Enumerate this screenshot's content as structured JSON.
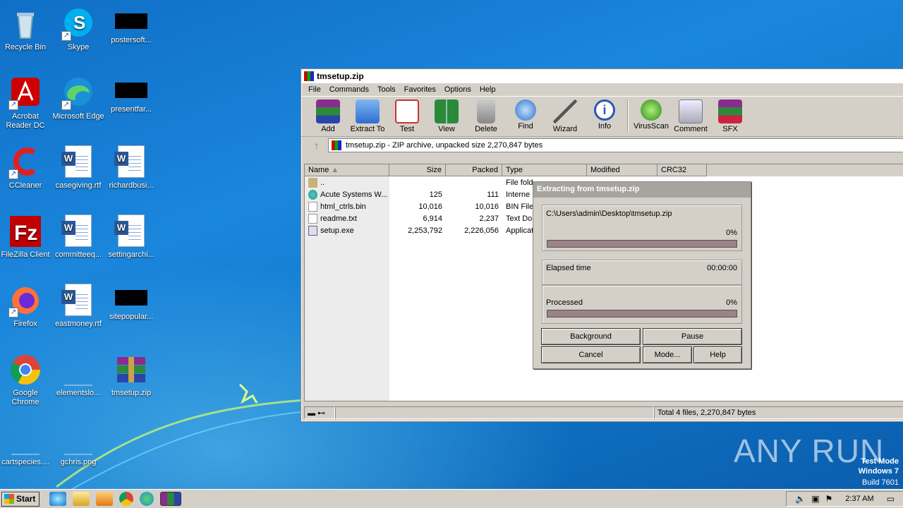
{
  "desktop_icons": [
    {
      "label": "Recycle Bin",
      "icon": "recycle-bin-icon"
    },
    {
      "label": "Skype",
      "icon": "skype-icon"
    },
    {
      "label": "postersoft...",
      "icon": "black-thumbnail"
    },
    {
      "label": "Acrobat Reader DC",
      "icon": "acrobat-icon"
    },
    {
      "label": "Microsoft Edge",
      "icon": "edge-icon"
    },
    {
      "label": "presentfar...",
      "icon": "black-thumbnail"
    },
    {
      "label": "CCleaner",
      "icon": "ccleaner-icon"
    },
    {
      "label": "casegiving.rtf",
      "icon": "word-doc-icon"
    },
    {
      "label": "richardbusi...",
      "icon": "word-doc-icon"
    },
    {
      "label": "FileZilla Client",
      "icon": "filezilla-icon"
    },
    {
      "label": "committeeq...",
      "icon": "word-doc-icon"
    },
    {
      "label": "settingarchi...",
      "icon": "word-doc-icon"
    },
    {
      "label": "Firefox",
      "icon": "firefox-icon"
    },
    {
      "label": "eastmoney.rtf",
      "icon": "word-doc-icon"
    },
    {
      "label": "sitepopular...",
      "icon": "black-thumbnail"
    },
    {
      "label": "Google Chrome",
      "icon": "chrome-icon"
    },
    {
      "label": "elementslo...",
      "icon": "blank-file-icon"
    },
    {
      "label": "tmsetup.zip",
      "icon": "winrar-icon"
    },
    {
      "label": "cartspecies....",
      "icon": "blank-file-icon"
    },
    {
      "label": "gchris.png",
      "icon": "blank-file-icon"
    }
  ],
  "window": {
    "title": "tmsetup.zip",
    "menu": [
      "File",
      "Commands",
      "Tools",
      "Favorites",
      "Options",
      "Help"
    ],
    "toolbar": [
      "Add",
      "Extract To",
      "Test",
      "View",
      "Delete",
      "Find",
      "Wizard",
      "Info",
      "VirusScan",
      "Comment",
      "SFX"
    ],
    "address": "tmsetup.zip - ZIP archive, unpacked size 2,270,847 bytes",
    "columns": [
      "Name",
      "Size",
      "Packed",
      "Type",
      "Modified",
      "CRC32"
    ],
    "files": [
      {
        "name": "..",
        "size": "",
        "packed": "",
        "type": "File fold"
      },
      {
        "name": "Acute Systems W...",
        "size": "125",
        "packed": "111",
        "type": "Interne"
      },
      {
        "name": "html_ctrls.bin",
        "size": "10,016",
        "packed": "10,016",
        "type": "BIN File"
      },
      {
        "name": "readme.txt",
        "size": "6,914",
        "packed": "2,237",
        "type": "Text Do"
      },
      {
        "name": "setup.exe",
        "size": "2,253,792",
        "packed": "2,226,056",
        "type": "Applicat"
      }
    ],
    "status": "Total 4 files, 2,270,847 bytes"
  },
  "dialog": {
    "title": "Extracting from tmsetup.zip",
    "path": "C:\\Users\\admin\\Desktop\\tmsetup.zip",
    "file_percent": "0%",
    "elapsed_label": "Elapsed time",
    "elapsed_value": "00:00:00",
    "processed_label": "Processed",
    "processed_percent": "0%",
    "buttons": {
      "background": "Background",
      "pause": "Pause",
      "cancel": "Cancel",
      "mode": "Mode...",
      "help": "Help"
    }
  },
  "taskbar": {
    "start": "Start",
    "time": "2:37 AM"
  },
  "watermark": {
    "brand": "ANY RUN",
    "mode": "Test Mode",
    "os": "Windows 7",
    "build": "Build 7601"
  }
}
